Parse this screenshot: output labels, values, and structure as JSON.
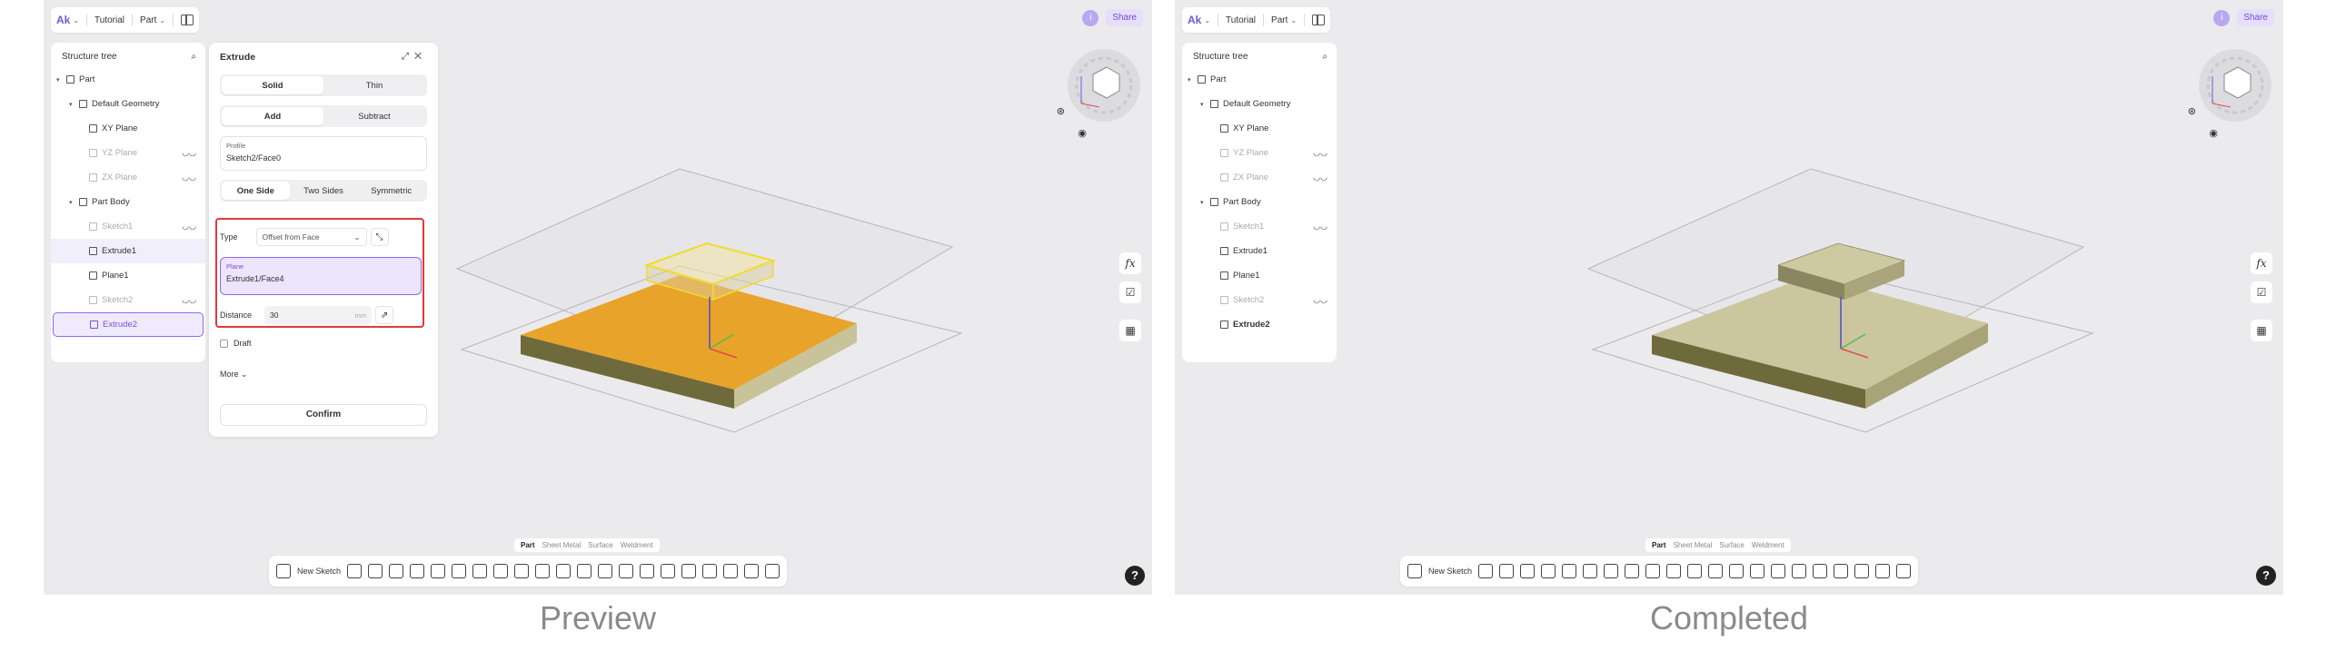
{
  "header": {
    "app": "Tutorial",
    "mode": "Part",
    "share": "Share",
    "info": "i"
  },
  "tree": {
    "title": "Structure tree",
    "items": [
      {
        "label": "Part"
      },
      {
        "label": "Default Geometry"
      },
      {
        "label": "XY Plane"
      },
      {
        "label": "YZ Plane"
      },
      {
        "label": "ZX Plane"
      },
      {
        "label": "Part Body"
      },
      {
        "label": "Sketch1"
      },
      {
        "label": "Extrude1"
      },
      {
        "label": "Plane1"
      },
      {
        "label": "Sketch2"
      },
      {
        "label": "Extrude2"
      }
    ]
  },
  "extrude": {
    "title": "Extrude",
    "solid": "Solid",
    "thin": "Thin",
    "add": "Add",
    "subtract": "Subtract",
    "profile_label": "Profile",
    "profile_value": "Sketch2/Face0",
    "one_side": "One Side",
    "two_sides": "Two Sides",
    "symmetric": "Symmetric",
    "type_label": "Type",
    "type_value": "Offset from Face",
    "plane_label": "Plane",
    "plane_value": "Extrude1/Face4",
    "distance_label": "Distance",
    "distance_value": "30",
    "distance_unit": "mm",
    "draft": "Draft",
    "more": "More",
    "confirm": "Confirm"
  },
  "workbench_tabs": [
    "Part",
    "Sheet Metal",
    "Surface",
    "Weldment"
  ],
  "toolbar": {
    "new_sketch": "New Sketch"
  },
  "side": {
    "fx": "fx"
  },
  "help": "?",
  "captions": {
    "left": "Preview",
    "right": "Completed"
  },
  "colors": {
    "accent": "#7a4fe0",
    "highlight": "#e03a3a",
    "body_preview": "#e5a52e",
    "body_completed": "#c9c49a"
  }
}
